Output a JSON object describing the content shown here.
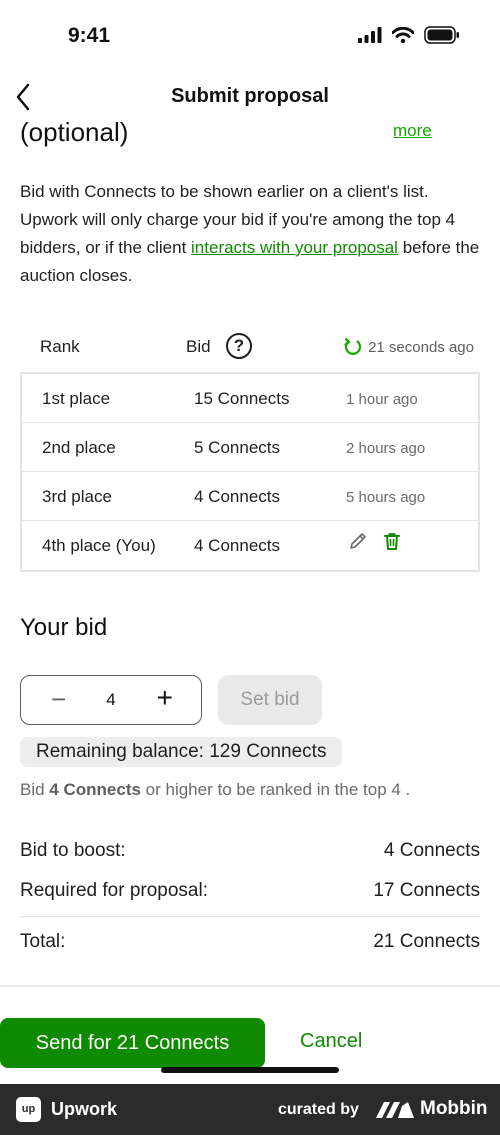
{
  "status_bar": {
    "time": "9:41"
  },
  "nav": {
    "title": "Submit proposal"
  },
  "section": {
    "title": "(optional)",
    "more_link": "more"
  },
  "description": {
    "part1": "Bid with Connects to be shown earlier on a client's list. Upwork will only charge your bid if you're among the top 4 bidders, or if the client ",
    "link": "interacts with your proposal",
    "part2": " before the auction closes."
  },
  "table": {
    "headers": {
      "rank": "Rank",
      "bid": "Bid",
      "help": "?",
      "updated": "21 seconds ago"
    },
    "rows": [
      {
        "rank": "1st place",
        "bid": "15 Connects",
        "time": "1 hour ago"
      },
      {
        "rank": "2nd place",
        "bid": "5 Connects",
        "time": "2 hours ago"
      },
      {
        "rank": "3rd place",
        "bid": "4 Connects",
        "time": "5 hours ago"
      },
      {
        "rank": "4th place (You)",
        "bid": "4 Connects",
        "time": ""
      }
    ]
  },
  "your_bid": {
    "title": "Your bid",
    "value": "4",
    "minus": "−",
    "plus": "+",
    "set_bid_label": "Set bid",
    "balance": "Remaining balance: 129 Connects",
    "hint_prefix": "Bid ",
    "hint_amount": "4 Connects",
    "hint_suffix": " or higher to be ranked in the top 4 ."
  },
  "summary": {
    "boost_label": "Bid to boost:",
    "boost_value": "4 Connects",
    "required_label": "Required for proposal:",
    "required_value": "17 Connects",
    "total_label": "Total:",
    "total_value": "21 Connects"
  },
  "actions": {
    "send": "Send for 21 Connects",
    "cancel": "Cancel"
  },
  "footer": {
    "logo": "up",
    "app": "Upwork",
    "curated": "curated by",
    "brand": "Mobbin"
  },
  "colors": {
    "accent": "#108a00",
    "link": "#14a800",
    "footer_bg": "#2b2b2b"
  }
}
